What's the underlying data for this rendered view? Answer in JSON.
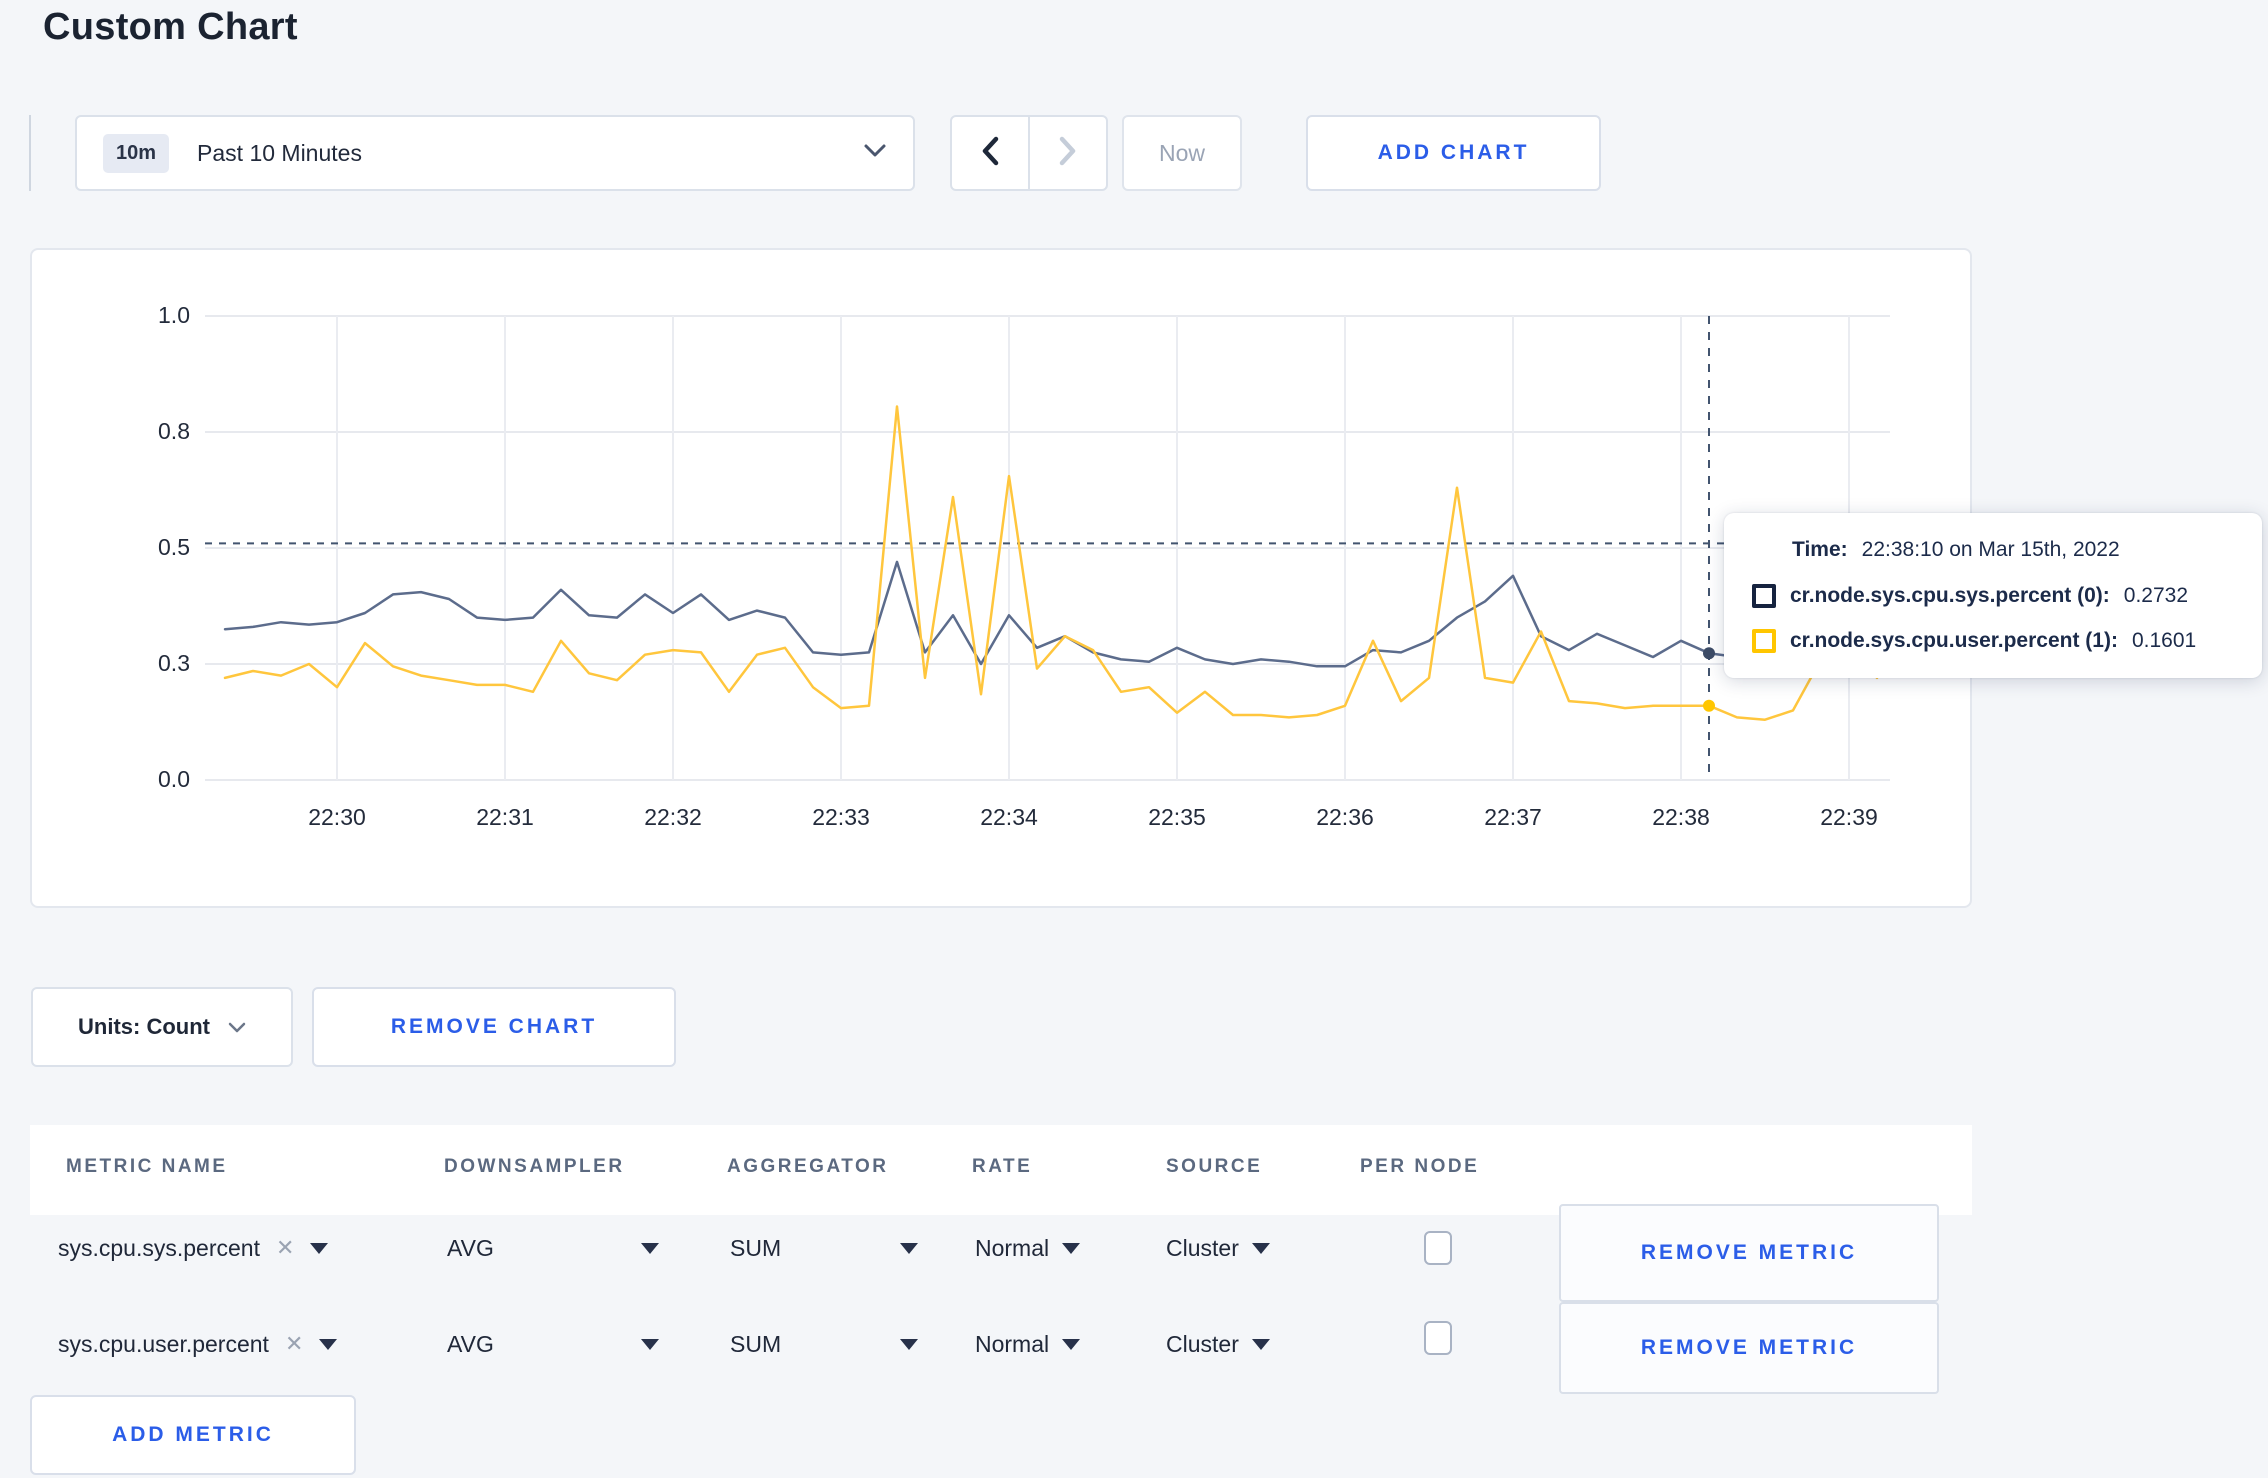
{
  "page": {
    "title": "Custom Chart",
    "background": "#f4f6f9",
    "accent_blue": "#2b5de8"
  },
  "toolbar": {
    "time_range": {
      "badge": "10m",
      "label": "Past 10 Minutes"
    },
    "now_label": "Now",
    "add_chart_label": "ADD CHART"
  },
  "chart_data": {
    "type": "line",
    "title": "",
    "xlabel": "",
    "ylabel": "",
    "ylim": [
      0,
      1
    ],
    "grid": true,
    "legend_position": "tooltip",
    "x_ticks": [
      "22:30",
      "22:31",
      "22:32",
      "22:33",
      "22:34",
      "22:35",
      "22:36",
      "22:37",
      "22:38",
      "22:39"
    ],
    "y_tick_labels": [
      "0.0",
      "0.3",
      "0.5",
      "0.8",
      "1.0"
    ],
    "y_tick_values": [
      0,
      0.25,
      0.5,
      0.75,
      1.0
    ],
    "x_start": "22:29:20",
    "x_interval_seconds": 10,
    "series": [
      {
        "name": "cr.node.sys.cpu.sys.percent (0)",
        "color": "#5c6c8c",
        "values": [
          0.325,
          0.33,
          0.34,
          0.335,
          0.34,
          0.36,
          0.4,
          0.405,
          0.39,
          0.35,
          0.345,
          0.35,
          0.41,
          0.355,
          0.35,
          0.4,
          0.36,
          0.4,
          0.345,
          0.365,
          0.35,
          0.275,
          0.27,
          0.275,
          0.47,
          0.275,
          0.355,
          0.25,
          0.355,
          0.285,
          0.31,
          0.275,
          0.26,
          0.255,
          0.285,
          0.26,
          0.25,
          0.26,
          0.255,
          0.245,
          0.245,
          0.28,
          0.275,
          0.3,
          0.35,
          0.385,
          0.44,
          0.31,
          0.28,
          0.315,
          0.29,
          0.265,
          0.3,
          0.2732,
          0.265,
          0.275,
          0.305,
          0.275,
          0.295,
          0.275
        ]
      },
      {
        "name": "cr.node.sys.cpu.user.percent (1)",
        "color": "#ffc63d",
        "values": [
          0.22,
          0.235,
          0.225,
          0.25,
          0.2,
          0.295,
          0.245,
          0.225,
          0.215,
          0.205,
          0.205,
          0.19,
          0.3,
          0.23,
          0.215,
          0.27,
          0.28,
          0.275,
          0.19,
          0.27,
          0.285,
          0.2,
          0.155,
          0.16,
          0.805,
          0.22,
          0.61,
          0.185,
          0.655,
          0.24,
          0.31,
          0.28,
          0.19,
          0.2,
          0.145,
          0.19,
          0.14,
          0.14,
          0.135,
          0.14,
          0.16,
          0.3,
          0.17,
          0.22,
          0.63,
          0.22,
          0.21,
          0.32,
          0.17,
          0.165,
          0.155,
          0.16,
          0.16,
          0.1601,
          0.135,
          0.13,
          0.15,
          0.26,
          0.285,
          0.22
        ]
      }
    ],
    "hover": {
      "x_time": "22:38:10",
      "hline_value": 0.51,
      "values": [
        0.2732,
        0.1601
      ],
      "dot_colors": [
        "#3d4c67",
        "#ffc600"
      ],
      "crosshair_color": "#42546f"
    }
  },
  "tooltip": {
    "time_prefix": "Time:",
    "time_value": "22:38:10 on Mar 15th, 2022",
    "rows": [
      {
        "label": "cr.node.sys.cpu.sys.percent (0):",
        "value": "0.2732",
        "swatch_color": "#16233f"
      },
      {
        "label": "cr.node.sys.cpu.user.percent (1):",
        "value": "0.1601",
        "swatch_color": "#ffc600"
      }
    ]
  },
  "units_bar": {
    "units_label": "Units: Count",
    "remove_chart_label": "REMOVE CHART"
  },
  "metrics_table": {
    "headers": [
      "METRIC NAME",
      "DOWNSAMPLER",
      "AGGREGATOR",
      "RATE",
      "SOURCE",
      "PER NODE"
    ],
    "rows": [
      {
        "metric": "sys.cpu.sys.percent",
        "downsampler": "AVG",
        "aggregator": "SUM",
        "rate": "Normal",
        "source": "Cluster",
        "per_node_checked": false,
        "remove_label": "REMOVE METRIC"
      },
      {
        "metric": "sys.cpu.user.percent",
        "downsampler": "AVG",
        "aggregator": "SUM",
        "rate": "Normal",
        "source": "Cluster",
        "per_node_checked": false,
        "remove_label": "REMOVE METRIC"
      }
    ],
    "add_metric_label": "ADD METRIC"
  },
  "icons": {
    "time_select": "chevron-down-icon",
    "nav_prev": "chevron-left-icon",
    "nav_next": "chevron-right-icon",
    "units": "chevron-down-icon",
    "row_selects": "caret-down-icon",
    "metric_clear": "clear-x-icon"
  }
}
